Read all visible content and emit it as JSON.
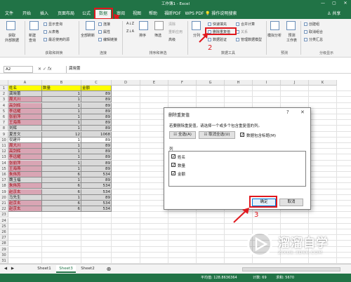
{
  "app": {
    "title": "工作簿1 - Excel",
    "window_controls": [
      "—",
      "▢",
      "✕"
    ]
  },
  "tabs": [
    "文件",
    "开始",
    "插入",
    "页面布局",
    "公式",
    "数据",
    "审阅",
    "视图",
    "帮助",
    "福昕PDF",
    "WPS PDF"
  ],
  "active_tab": "数据",
  "tell_me": "操作说明搜索",
  "share_label": "共享",
  "ribbon": {
    "get_external": "获取\n外部数据",
    "new_query": "新建\n查询",
    "show_query": "显示查询",
    "from_table": "从表格",
    "recent_sources": "最近使用的源",
    "group_get_transform": "获取和转换",
    "refresh_all": "全部刷新",
    "connections": "连接",
    "properties": "属性",
    "edit_links": "编辑链接",
    "group_connections": "连接",
    "sort": "排序",
    "filter": "筛选",
    "clear": "清除",
    "reapply": "重新应用",
    "advanced": "高级",
    "group_sort_filter": "排序和筛选",
    "text_to_columns": "分列",
    "flash_fill": "快速填充",
    "remove_duplicates": "删除重复值",
    "data_validation": "数据验证",
    "consolidate": "合并计算",
    "relationships": "关系",
    "manage_data_model": "管理数据模型",
    "group_data_tools": "数据工具",
    "what_if": "模拟分析",
    "forecast_sheet": "预测\n工作表",
    "group_forecast": "预测",
    "group": "创建组",
    "ungroup": "取消组合",
    "subtotal": "分类汇总",
    "group_outline": "分级显示"
  },
  "formula_bar": {
    "name_box": "A2",
    "value": "龚晓蕾"
  },
  "columns": [
    "A",
    "B",
    "C",
    "D",
    "E",
    "F",
    "G",
    "H",
    "I",
    "J",
    "K"
  ],
  "rows": [
    "1",
    "2",
    "3",
    "4",
    "5",
    "6",
    "7",
    "8",
    "9",
    "10",
    "11",
    "12",
    "13",
    "14",
    "15",
    "16",
    "17",
    "18",
    "19",
    "20",
    "21",
    "22",
    "23",
    "24",
    "25",
    "26",
    "27",
    "28",
    "29",
    "30",
    "31"
  ],
  "table": {
    "headers": [
      "姓名",
      "数量",
      "金额"
    ],
    "records": [
      {
        "name": "龚晓蕾",
        "qty": "1",
        "amt": "89",
        "style": "gray"
      },
      {
        "name": "周大川",
        "qty": "1",
        "amt": "89",
        "style": "dup"
      },
      {
        "name": "高剑辉",
        "qty": "1",
        "amt": "89",
        "style": "dup"
      },
      {
        "name": "李远耀",
        "qty": "1",
        "amt": "89",
        "style": "dup"
      },
      {
        "name": "张丽萍",
        "qty": "1",
        "amt": "89",
        "style": "dup"
      },
      {
        "name": "王海燕",
        "qty": "1",
        "amt": "89",
        "style": "dup"
      },
      {
        "name": "刘辉",
        "qty": "1",
        "amt": "89",
        "style": "gray"
      },
      {
        "name": "夏言文",
        "qty": "12",
        "amt": "1068",
        "style": "gray"
      },
      {
        "name": "倪建开",
        "qty": "1",
        "amt": "89",
        "style": "white"
      },
      {
        "name": "周大川",
        "qty": "1",
        "amt": "89",
        "style": "dup"
      },
      {
        "name": "高剑辉",
        "qty": "1",
        "amt": "89",
        "style": "dup"
      },
      {
        "name": "李远耀",
        "qty": "1",
        "amt": "89",
        "style": "dup"
      },
      {
        "name": "张丽萍",
        "qty": "1",
        "amt": "89",
        "style": "dup"
      },
      {
        "name": "王海燕",
        "qty": "1",
        "amt": "89",
        "style": "dup"
      },
      {
        "name": "朱伟芳",
        "qty": "6",
        "amt": "534",
        "style": "dup"
      },
      {
        "name": "魏玉福",
        "qty": "1",
        "amt": "89",
        "style": "gray"
      },
      {
        "name": "朱伟芳",
        "qty": "6",
        "amt": "534",
        "style": "dup"
      },
      {
        "name": "赵京玄",
        "qty": "6",
        "amt": "534",
        "style": "dup"
      },
      {
        "name": "马先生",
        "qty": "1",
        "amt": "89",
        "style": "gray"
      },
      {
        "name": "赵京玄",
        "qty": "6",
        "amt": "534",
        "style": "dup"
      },
      {
        "name": "赵京玄",
        "qty": "6",
        "amt": "534",
        "style": "dup"
      }
    ]
  },
  "sheets": [
    "Sheet1",
    "Sheet3",
    "Sheet2"
  ],
  "active_sheet": "Sheet3",
  "status": {
    "average": "平均值: 128.8636364",
    "count": "计数: 69",
    "sum": "求和: 5670"
  },
  "dialog": {
    "title": "删除重复值",
    "help": "?",
    "close": "✕",
    "description": "若要删除重复值，请选择一个或多个包含重复值的列。",
    "select_all": "全选(A)",
    "unselect_all": "取消全选(U)",
    "has_headers": "数据包含标题(M)",
    "columns_label": "列",
    "columns": [
      "姓名",
      "数量",
      "金额"
    ],
    "ok": "确定",
    "cancel": "取消"
  },
  "annotations": [
    "1",
    "2",
    "3"
  ],
  "watermark": {
    "text": "溜溜自学",
    "url": "ZIXUE.3D66.COM"
  },
  "colors": {
    "excel_green": "#217346",
    "annotation_red": "#e0181e",
    "duplicate_fill": "#d9a5b4",
    "header_fill": "#ffff00"
  }
}
